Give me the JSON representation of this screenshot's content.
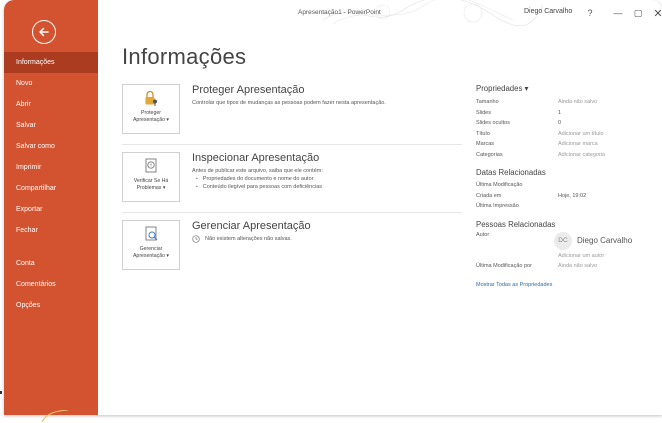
{
  "window": {
    "title": "Apresentação1 - PowerPoint",
    "user": "Diego Carvalho",
    "help_label": "?",
    "min_label": "—",
    "max_label": "▢",
    "close_label": "✕"
  },
  "colors": {
    "sidebar": "#d35230",
    "sidebar_active": "#ab3c20",
    "link": "#2b6aa6"
  },
  "sidebar": {
    "items": [
      {
        "label": "Informações",
        "active": true
      },
      {
        "label": "Novo"
      },
      {
        "label": "Abrir"
      },
      {
        "label": "Salvar"
      },
      {
        "label": "Salvar como"
      },
      {
        "label": "Imprimir"
      },
      {
        "label": "Compartilhar"
      },
      {
        "label": "Exportar"
      },
      {
        "label": "Fechar"
      },
      {
        "label": "Conta"
      },
      {
        "label": "Comentários"
      },
      {
        "label": "Opções"
      }
    ]
  },
  "page_title": "Informações",
  "cards": {
    "protect": {
      "icon": "lock-key-icon",
      "button_label_1": "Proteger",
      "button_label_2": "Apresentação ▾",
      "title": "Proteger Apresentação",
      "desc": "Controlar que tipos de mudanças as pessoas podem fazer nesta apresentação."
    },
    "inspect": {
      "icon": "inspect-doc-icon",
      "button_label_1": "Verificar Se Há",
      "button_label_2": "Problemas ▾",
      "title": "Inspecionar Apresentação",
      "desc": "Antes de publicar este arquivo, saiba que ele contém:",
      "bullets": [
        "Propriedades do documento e nome do autor",
        "Conteúdo ilegível para pessoas com deficiências"
      ]
    },
    "manage": {
      "icon": "manage-doc-icon",
      "button_label_1": "Gerenciar",
      "button_label_2": "Apresentação ▾",
      "title": "Gerenciar Apresentação",
      "state": "Não existem alterações não salvas."
    }
  },
  "properties": {
    "heading": "Propriedades ▾",
    "rows": [
      {
        "label": "Tamanho",
        "value": "Ainda não salvo",
        "muted": true
      },
      {
        "label": "Slides",
        "value": "1",
        "muted": false
      },
      {
        "label": "Slides ocultos",
        "value": "0",
        "muted": false
      },
      {
        "label": "Título",
        "value": "Adicionar um título",
        "muted": true
      },
      {
        "label": "Marcas",
        "value": "Adicionar marca",
        "muted": true
      },
      {
        "label": "Categorias",
        "value": "Adicionar categoria",
        "muted": true
      }
    ],
    "dates_heading": "Datas Relacionadas",
    "dates": [
      {
        "label": "Última Modificação",
        "value": ""
      },
      {
        "label": "Criada em",
        "value": "Hoje, 19:02"
      },
      {
        "label": "Última Impressão",
        "value": ""
      }
    ],
    "people_heading": "Pessoas Relacionadas",
    "author_label": "Autor",
    "author_initials": "DC",
    "author_name": "Diego Carvalho",
    "add_author": "Adicionar um autor",
    "last_modified_by_label": "Última Modificação por",
    "last_modified_by_value": "Ainda não salvo",
    "show_all": "Mostrar Todas as Propriedades"
  }
}
